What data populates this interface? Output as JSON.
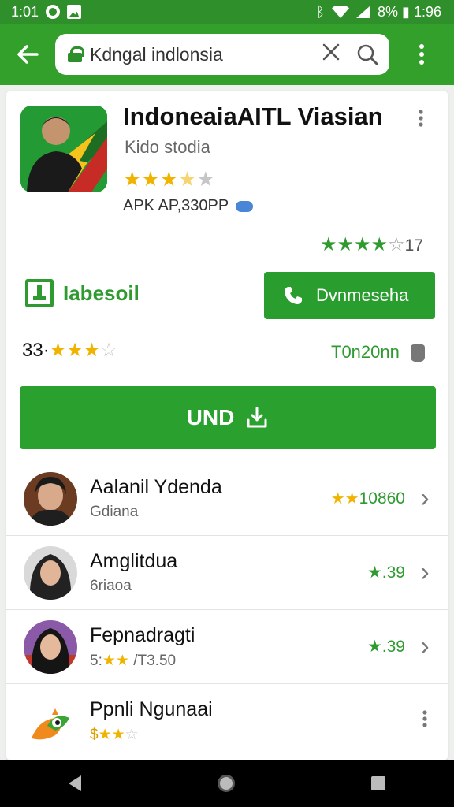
{
  "status_bar": {
    "time": "1:01",
    "right_text": "8% ▮ 1:96"
  },
  "app_bar": {
    "search_value": "Kdngal indlonsia",
    "icons": [
      "back-arrow-icon",
      "lock-icon",
      "close-icon",
      "search-icon",
      "overflow-menu-icon"
    ]
  },
  "app": {
    "name": "IndoneaiaAITL Viasian",
    "developer": "Kido stodia",
    "stars_filled": "★★★",
    "stars_half": "★",
    "stars_empty": "★",
    "apk_info": "APK AP,330PP"
  },
  "green_rating": {
    "stars_filled": "★★★★",
    "stars_empty": "☆",
    "value": "17"
  },
  "lable": {
    "text": "Iabesoil"
  },
  "call_button": {
    "label": "Dvnmeseha"
  },
  "rating_row": {
    "value": "33",
    "stars_filled": "★★★",
    "stars_empty": "☆"
  },
  "tonnage": {
    "text": "T0n20nn"
  },
  "install_button": {
    "label": "UND"
  },
  "list": [
    {
      "title": "Aalanil Ydenda",
      "subtitle": "Gdiana",
      "rating_stars": "★★",
      "rating_value": "10860"
    },
    {
      "title": "Amglitdua",
      "subtitle": "6riaoa",
      "rating_stars": "★",
      "rating_value": ".39"
    },
    {
      "title": "Fepnadragti",
      "subtitle_prefix": "5:",
      "subtitle_stars": "★★",
      "subtitle_value": " /T3.50",
      "rating_stars": "★",
      "rating_value": ".39"
    },
    {
      "title": "Ppnli Ngunaai",
      "subtitle_prefix": "$",
      "subtitle_stars": "★★",
      "subtitle_empty": "☆"
    }
  ],
  "colors": {
    "status_bar": "#2f8f2a",
    "app_bar": "#33a02c",
    "primary_green": "#2aa12f",
    "star_gold": "#f0b400"
  }
}
